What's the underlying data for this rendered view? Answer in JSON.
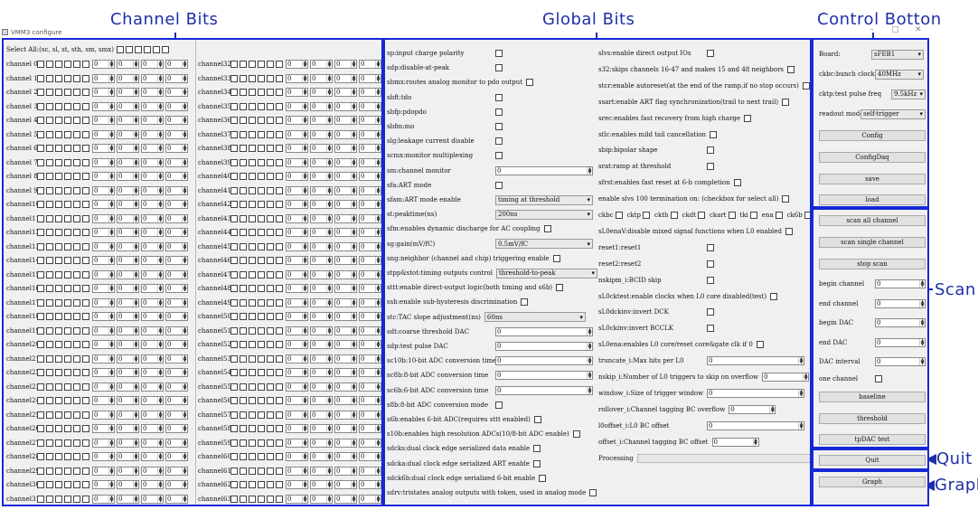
{
  "annotations": {
    "channel_bits": "Channel Bits",
    "global_bits": "Global Bits",
    "control_button": "Control Botton",
    "scan": "Scan",
    "quit": "Quit",
    "graph": "Graph"
  },
  "window": {
    "title": "VMM3 configure",
    "minimize": "–",
    "maximize": "□",
    "close": "✕"
  },
  "channel_panel": {
    "select_all_label": "Select All:(sc, sl, st, sth, sm, smx)",
    "spinbox_default": "0",
    "left_channels": [
      "channel 0",
      "channel 1",
      "channel 2",
      "channel 3",
      "channel 4",
      "channel 5",
      "channel 6",
      "channel 7",
      "channel 8",
      "channel 9",
      "channel10",
      "channel11",
      "channel12",
      "channel13",
      "channel14",
      "channel15",
      "channel16",
      "channel17",
      "channel18",
      "channel19",
      "channel20",
      "channel21",
      "channel22",
      "channel23",
      "channel24",
      "channel25",
      "channel26",
      "channel27",
      "channel28",
      "channel29",
      "channel30",
      "channel31"
    ],
    "right_channels": [
      "channel32",
      "channel33",
      "channel34",
      "channel35",
      "channel36",
      "channel37",
      "channel38",
      "channel39",
      "channel40",
      "channel41",
      "channel42",
      "channel43",
      "channel44",
      "channel45",
      "channel46",
      "channel47",
      "channel48",
      "channel49",
      "channel50",
      "channel51",
      "channel52",
      "channel53",
      "channel54",
      "channel55",
      "channel56",
      "channel57",
      "channel58",
      "channel59",
      "channel60",
      "channel61",
      "channel62",
      "channel63"
    ]
  },
  "global_left": [
    {
      "label": "sp:input charge polarity",
      "type": "check"
    },
    {
      "label": "sdp:disable-at-peak",
      "type": "check"
    },
    {
      "label": "sbmx:routes analog monitor to pdo output",
      "type": "check_inline"
    },
    {
      "label": "sbft:tdo",
      "type": "check"
    },
    {
      "label": "sbfp:pdopdo",
      "type": "check"
    },
    {
      "label": "sbfm:mo",
      "type": "check"
    },
    {
      "label": "slg:leakage current disable",
      "type": "check"
    },
    {
      "label": "scmx:monitor multiplexing",
      "type": "check"
    },
    {
      "label": "sm:channel monitor",
      "type": "spin",
      "value": "0"
    },
    {
      "label": "sfa:ART mode",
      "type": "check"
    },
    {
      "label": "sfam:ART mode enable",
      "type": "select",
      "value": "timing at threshold"
    },
    {
      "label": "st:peaktime(ns)",
      "type": "select",
      "value": "200ns"
    },
    {
      "label": "sfm:enables dynamic discharge for AC coupling",
      "type": "check_inline"
    },
    {
      "label": "sg:gain(mV/fC)",
      "type": "select",
      "value": "0.5mV/fC"
    },
    {
      "label": "sng:neighbor (channel and chip) triggering enable",
      "type": "check_inline"
    },
    {
      "label": "stpp&stot:timing outputs control",
      "type": "select_inline",
      "value": "threshold-to-peak"
    },
    {
      "label": "sttt:enable direct-output logic(both timing and s6b)",
      "type": "check_inline"
    },
    {
      "label": "ssh:enable sub-hysteresis discrimination",
      "type": "check_inline"
    },
    {
      "label": "stc:TAC slope adjustment(ns)",
      "type": "select_inline",
      "value": "60ns"
    },
    {
      "label": "sdt:coarse threshold DAC",
      "type": "spin",
      "value": "0"
    },
    {
      "label": "sdp:test pulse DAC",
      "type": "spin",
      "value": "0"
    },
    {
      "label": "sc10b:10-bit ADC conversion time",
      "type": "spin",
      "value": "0"
    },
    {
      "label": "sc8b:8-bit ADC conversion time",
      "type": "spin",
      "value": "0"
    },
    {
      "label": "sc6b:6-bit ADC conversion time",
      "type": "spin",
      "value": "0"
    },
    {
      "label": "s8b:8-bit ADC conversion mode",
      "type": "check"
    },
    {
      "label": "s6b:enables 6-bit ADC(requires sttt enabled)",
      "type": "check_inline"
    },
    {
      "label": "s10b:enables high resolution ADCs(10/8-bit ADC enable)",
      "type": "check_inline"
    },
    {
      "label": "sdcks:dual clock edge serialized data enable",
      "type": "check_inline"
    },
    {
      "label": "sdcka:dual clock edge serialized ART enable",
      "type": "check_inline"
    },
    {
      "label": "sdck6b:dual clock edge serialized 6-bit enable",
      "type": "check_inline"
    },
    {
      "label": "sdrv:tristates analog outputs with token, used in analog mode",
      "type": "check_inline"
    }
  ],
  "global_right": [
    {
      "label": "slvs:enable direct output IOs",
      "type": "check"
    },
    {
      "label": "s32:skips channels 16-47 and makes 15 and 48 neighbors",
      "type": "check_inline"
    },
    {
      "label": "stcr:enable autoreset(at the end of the ramp,if no stop occurs)",
      "type": "check_inline"
    },
    {
      "label": "ssart:enable ART flag synchronization(trail to next trail)",
      "type": "check_inline"
    },
    {
      "label": "srec:enables fast recovery from high charge",
      "type": "check_inline"
    },
    {
      "label": "stlc:enables mild tail cancellation",
      "type": "check_inline"
    },
    {
      "label": "sbip:bipolar shape",
      "type": "check"
    },
    {
      "label": "srat:ramp at threshold",
      "type": "check"
    },
    {
      "label": "sfrst:enables fast reset at 6-b completion",
      "type": "check_inline"
    },
    {
      "label": "enable slvs 100 termination on: (checkbox for select all)",
      "type": "check_inline"
    },
    {
      "label": "ckbc_row",
      "type": "cklist",
      "items": [
        "ckbc",
        "cktp",
        "ckth",
        "ckdt",
        "ckart",
        "tki",
        "ena",
        "ck6b"
      ]
    },
    {
      "label": "sL0enaV:disable mixed signal functions when L0 enabled",
      "type": "check_inline"
    },
    {
      "label": "reset1:reset1",
      "type": "check"
    },
    {
      "label": "reset2:reset2",
      "type": "check"
    },
    {
      "label": "nskipm_i:BCID skip",
      "type": "check"
    },
    {
      "label": "sL0cktest:enable clocks when L0 core disabled(test)",
      "type": "check_inline"
    },
    {
      "label": "sL0dckinv:invert DCK",
      "type": "check"
    },
    {
      "label": "sL0ckinv:invert BCCLK",
      "type": "check"
    },
    {
      "label": "sL0ena:enables L0 core/reset core&gate clk if 0",
      "type": "check_inline"
    },
    {
      "label": "truncate_i:Max hits per L0",
      "type": "spin",
      "value": "0"
    },
    {
      "label": "nskip_i:Number of L0 triggers to skip on overflow",
      "type": "spin_inline",
      "value": "0"
    },
    {
      "label": "window_i:Size of trigger window",
      "type": "spin",
      "value": "0"
    },
    {
      "label": "rollover_i:Channel tagging BC overflow",
      "type": "spin_inline",
      "value": "0"
    },
    {
      "label": "l0offset_i:L0 BC offset",
      "type": "spin",
      "value": "0"
    },
    {
      "label": "offset_i:Channel tagging BC offset",
      "type": "spin_inline",
      "value": "0"
    },
    {
      "label": "Processing",
      "type": "progress"
    }
  ],
  "control": {
    "board_label": "Board:",
    "board_value": "sFEB1",
    "ckbc_label": "ckbc:bunch clock",
    "ckbc_value": "40MHz",
    "cktp_label": "cktp:test pulse freq",
    "cktp_value": "9.5kHz",
    "readout_label": "readout mode",
    "readout_value": "self-trigger",
    "buttons": [
      "Config",
      "ConfigDaq",
      "save",
      "load"
    ]
  },
  "scan": {
    "scan_all": "scan all channel",
    "scan_single": "scan single channel",
    "stop_scan": "stop scan",
    "fields": [
      {
        "label": "begin channel",
        "value": "0"
      },
      {
        "label": "end channel",
        "value": "0"
      },
      {
        "label": "begin DAC",
        "value": "0"
      },
      {
        "label": "end DAC",
        "value": "0"
      },
      {
        "label": "DAC interval",
        "value": "0"
      }
    ],
    "one_channel": "one channel",
    "buttons": [
      "baseline",
      "threshold",
      "tpDAC test"
    ]
  },
  "quit_button": "Quit",
  "graph_button": "Graph",
  "colors": {
    "annotation": "#1f2fa8",
    "panel_border": "#1628d6",
    "panel_bg": "#f0f0f0"
  }
}
